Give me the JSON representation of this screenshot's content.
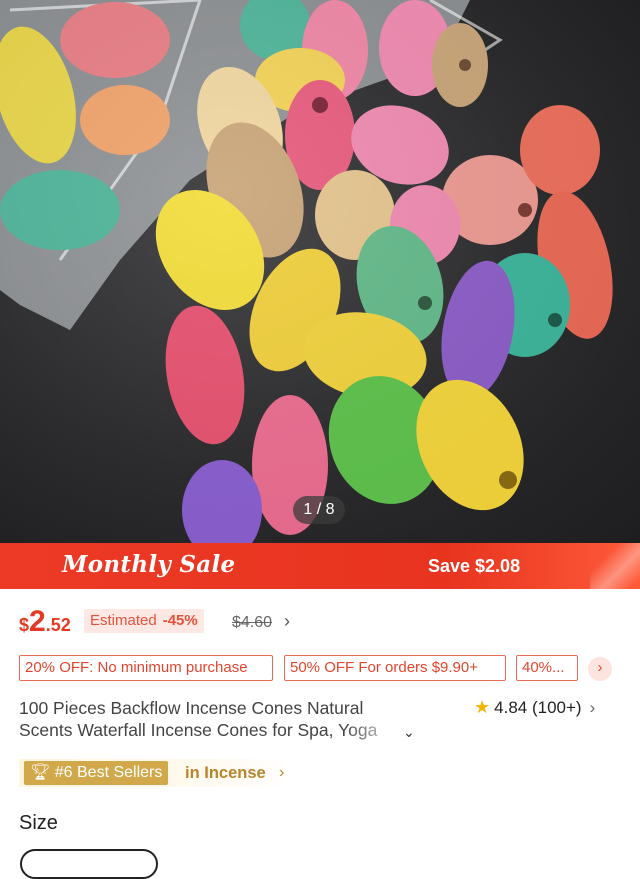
{
  "gallery": {
    "counter": "1 / 8",
    "image_alt": "colorful backflow incense cones spilling from a clear bag"
  },
  "banner": {
    "title": "Monthly Sale",
    "save": "Save $2.08"
  },
  "price": {
    "currency": "$",
    "integer": "2",
    "decimal": ".52",
    "estimated_label": "Estimated",
    "discount": "-45%",
    "original": "$4.60",
    "arrow": "›"
  },
  "coupons": [
    {
      "text": "20% OFF: No minimum purchase"
    },
    {
      "text": "50% OFF For orders $9.90+"
    },
    {
      "text": "40%..."
    }
  ],
  "coupon_more_icon": "chevron-right-icon",
  "product": {
    "title_line1": "100 Pieces Backflow Incense Cones Natural",
    "title_line2": "Scents Waterfall Incense Cones for Spa, Yoga",
    "rating": "4.84",
    "reviews": "(100+)"
  },
  "best_seller": {
    "rank": "#6 Best Sellers",
    "category": "in Incense"
  },
  "size": {
    "label": "Size"
  },
  "colors": {
    "accent": "#e8341f",
    "gold": "#d1a94b",
    "star": "#f5b400"
  }
}
